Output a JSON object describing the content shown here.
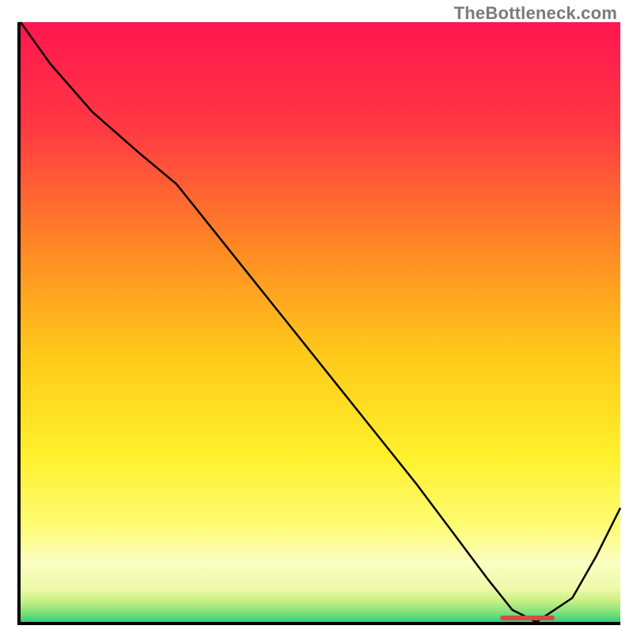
{
  "watermark": {
    "text": "TheBottleneck.com"
  },
  "chart_data": {
    "type": "line",
    "title": "",
    "xlabel": "",
    "ylabel": "",
    "xlim": [
      0,
      100
    ],
    "ylim": [
      0,
      100
    ],
    "grid": false,
    "legend": false,
    "annotations": [],
    "background": {
      "kind": "vertical-gradient",
      "stops": [
        {
          "offset": 0.0,
          "color": "#ff1650"
        },
        {
          "offset": 0.18,
          "color": "#ff3a42"
        },
        {
          "offset": 0.38,
          "color": "#ff8a24"
        },
        {
          "offset": 0.55,
          "color": "#ffc81a"
        },
        {
          "offset": 0.72,
          "color": "#fff02a"
        },
        {
          "offset": 0.84,
          "color": "#fffc75"
        },
        {
          "offset": 0.9,
          "color": "#fbfec1"
        },
        {
          "offset": 0.945,
          "color": "#edf9a9"
        },
        {
          "offset": 0.965,
          "color": "#c9f084"
        },
        {
          "offset": 0.985,
          "color": "#7de07a"
        },
        {
          "offset": 1.0,
          "color": "#2dd17a"
        }
      ]
    },
    "series": [
      {
        "name": "bottleneck-curve",
        "color": "#000000",
        "width": 2,
        "x": [
          0,
          5,
          12,
          20,
          26,
          34,
          42,
          50,
          58,
          66,
          72,
          78,
          82,
          86,
          92,
          96,
          100
        ],
        "y": [
          100,
          93,
          85,
          78,
          73,
          63,
          53,
          43,
          33,
          23,
          15,
          7,
          2,
          0,
          4,
          11,
          19
        ]
      }
    ],
    "markers": [
      {
        "name": "optimum-band",
        "x_start": 80,
        "x_end": 89,
        "y": 0.5,
        "color": "#d94a45"
      }
    ]
  },
  "colors": {
    "axis": "#000000",
    "curve": "#000000",
    "marker": "#d94a45",
    "watermark": "#7a7a7a"
  }
}
